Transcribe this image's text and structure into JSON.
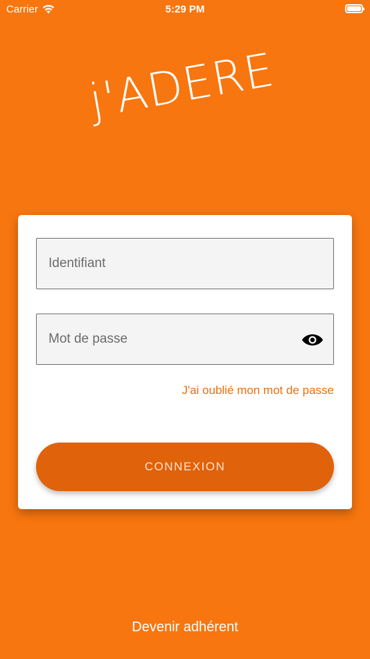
{
  "status_bar": {
    "carrier": "Carrier",
    "time": "5:29 PM"
  },
  "app": {
    "logo_text": "j'ADERE",
    "brand_color": "#F7760F"
  },
  "login_form": {
    "username_placeholder": "Identifiant",
    "username_value": "",
    "password_placeholder": "Mot de passe",
    "password_value": "",
    "forgot_password": "J'ai oublié mon mot de passe",
    "submit_label": "CONNEXION",
    "button_color": "#E0620A",
    "link_color": "#EC6F0E"
  },
  "footer": {
    "register_link": "Devenir adhérent"
  }
}
